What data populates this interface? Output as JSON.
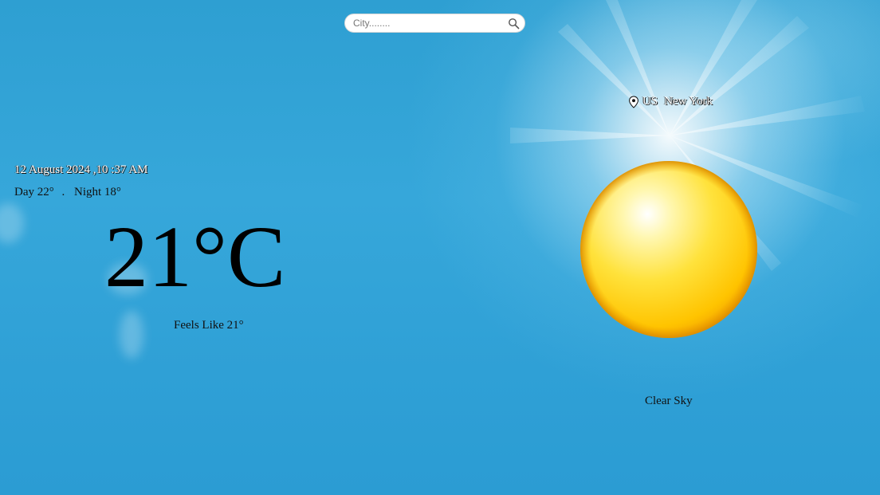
{
  "search": {
    "placeholder": "City........",
    "value": "",
    "icon": "search-icon"
  },
  "location": {
    "icon": "map-pin-icon",
    "country": "US",
    "city": "New York"
  },
  "datetime": {
    "text": "12 August 2024 ,10 :37 AM"
  },
  "forecast": {
    "day_label": "Day",
    "day_temp": "22°",
    "separator": ".",
    "night_label": "Night",
    "night_temp": "18°"
  },
  "current": {
    "temperature": "21°C",
    "feels_like": "Feels Like 21°"
  },
  "condition": {
    "icon": "sun-icon",
    "text": "Clear Sky"
  },
  "colors": {
    "sky": "#2fa0d6",
    "sun_core": "#ffe45a",
    "sun_edge": "#f5a800"
  }
}
